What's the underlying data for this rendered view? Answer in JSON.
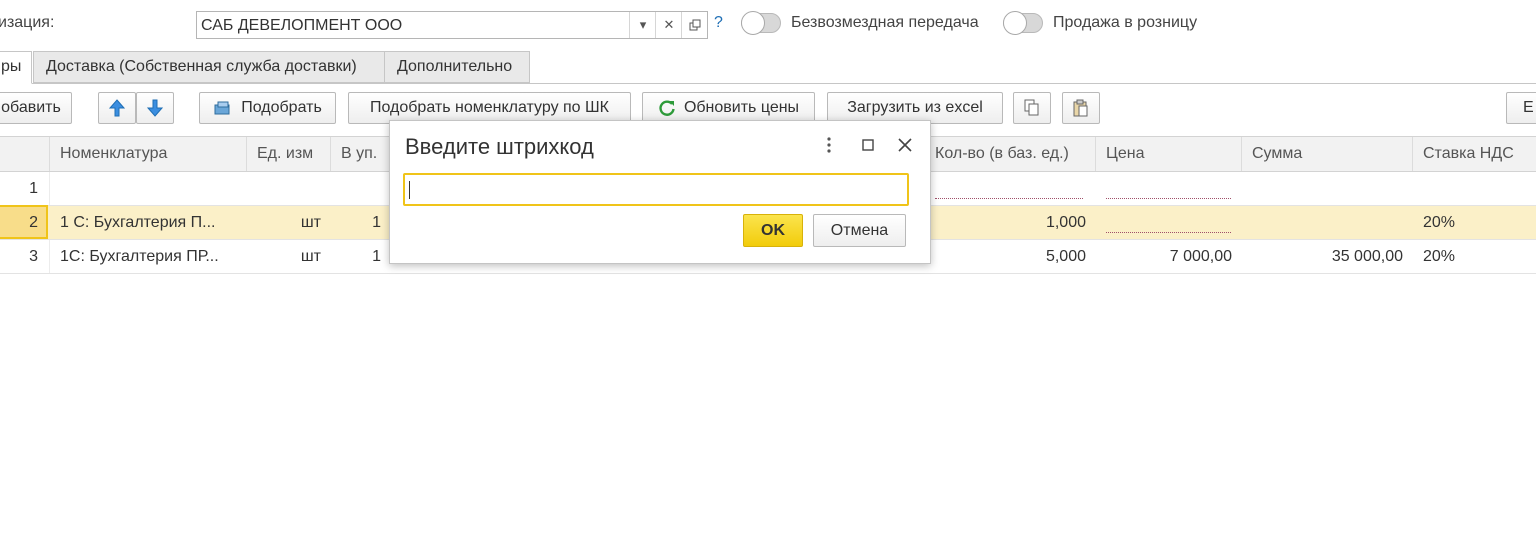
{
  "header": {
    "org_label": "изация:",
    "org_value": "САБ ДЕВЕЛОПМЕНТ ООО",
    "help": "?",
    "toggle1_label": "Безвозмездная передача",
    "toggle2_label": "Продажа в розницу"
  },
  "tabs": [
    {
      "label": "ры"
    },
    {
      "label": "Доставка (Собственная служба доставки)"
    },
    {
      "label": "Дополнительно"
    }
  ],
  "toolbar": {
    "add": "обавить",
    "pick": "Подобрать",
    "pick_barcode": "Подобрать номенклатуру по ШК",
    "refresh_prices": "Обновить цены",
    "load_excel": "Загрузить из excel",
    "more": "Е"
  },
  "table": {
    "columns": {
      "item": "Номенклатура",
      "unit": "Ед. изм",
      "pack": "В уп.",
      "qty_base": "Кол-во (в баз. ед.)",
      "price": "Цена",
      "sum": "Сумма",
      "vat": "Ставка НДС"
    },
    "rows": [
      {
        "n": "1",
        "item": "",
        "unit": "",
        "pack": "",
        "qty_base": "",
        "price": "",
        "sum": "",
        "vat": ""
      },
      {
        "n": "2",
        "item": "1 С:  Бухгалтерия П...",
        "unit": "шт",
        "pack": "1",
        "qty_base": "1,000",
        "price": "",
        "sum": "",
        "vat": "20%"
      },
      {
        "n": "3",
        "item": "1С: Бухгалтерия ПР...",
        "unit": "шт",
        "pack": "1",
        "qty_base": "5,000",
        "price": "7 000,00",
        "sum": "35 000,00",
        "vat": "20%"
      }
    ]
  },
  "dialog": {
    "title": "Введите штрихкод",
    "input_value": "",
    "ok": "OK",
    "cancel": "Отмена"
  },
  "colors": {
    "accent_yellow": "#f2cc0b",
    "selected_row": "#fbf0c8",
    "icon_blue": "#1f6fb5",
    "refresh_green": "#2e9b3a"
  }
}
